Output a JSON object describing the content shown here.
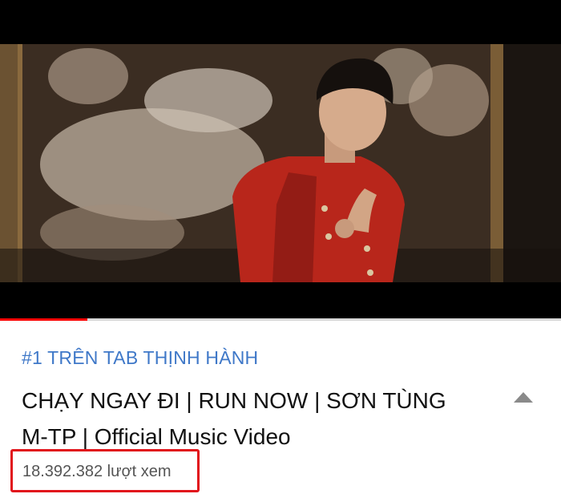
{
  "video": {
    "watched_fraction": 0.155,
    "thumbnail_alt": "Music video frame"
  },
  "info": {
    "trending_label": "#1 TRÊN TAB THỊNH HÀNH",
    "title_line1": "CHẠY NGAY ĐI | RUN NOW | SƠN TÙNG",
    "title_line2": "M-TP | Official Music Video",
    "views": "18.392.382 lượt xem",
    "collapse_icon": "chevron-up-icon"
  },
  "colors": {
    "trending": "#3f78c8",
    "progress": "#ff0000",
    "highlight_box": "#e1141c"
  }
}
